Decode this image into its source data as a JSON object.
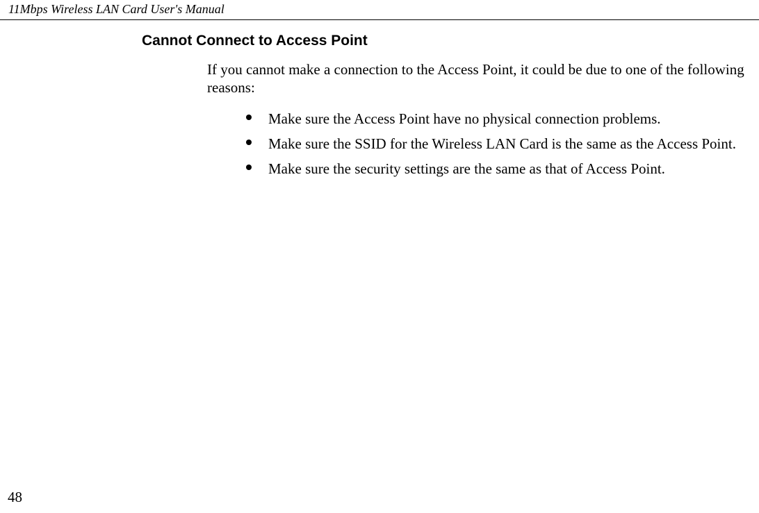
{
  "header": {
    "title": "11Mbps Wireless LAN Card User's Manual"
  },
  "section": {
    "heading": "Cannot Connect to Access Point",
    "intro": "If you cannot make a connection to the Access Point, it could be due to one of the following reasons:",
    "bullets": [
      "Make sure the Access Point have no physical connection problems.",
      "Make sure the SSID for the Wireless LAN Card is the same as the Access Point.",
      "Make sure the security settings are the same as that of Access Point."
    ]
  },
  "footer": {
    "page_number": "48"
  }
}
